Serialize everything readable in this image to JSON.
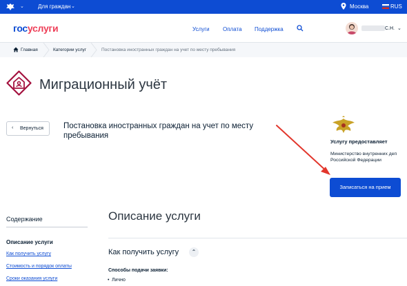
{
  "topbar": {
    "audience": "Для граждан",
    "city": "Москва",
    "language": "RUS"
  },
  "header": {
    "logo_part1": "гос",
    "logo_part2": "услуги",
    "nav": [
      "Услуги",
      "Оплата",
      "Поддержка"
    ],
    "user_initials": "С.Н."
  },
  "breadcrumb": {
    "items": [
      "Главная",
      "Категории услуг",
      "Постановка иностранных граждан на учет по месту пребывания"
    ]
  },
  "page": {
    "title": "Миграционный учёт",
    "back_label": "Вернуться",
    "service_name": "Постановка иностранных граждан на учет по месту пребывания"
  },
  "provider": {
    "label": "Услугу предоставляет",
    "name_line1": "Министерство внутренних деп",
    "name_line2": "Российской Федерации",
    "book_label": "Записаться на прием"
  },
  "toc": {
    "title": "Содержание",
    "active": "Описание услуги",
    "links": [
      "Как получить услугу",
      "Стоимость и порядок оплаты",
      "Сроки оказания услуги"
    ]
  },
  "description": {
    "title": "Описание услуги",
    "how_title": "Как получить услугу",
    "methods_label": "Способы подачи заявки:",
    "methods": [
      "Лично"
    ]
  },
  "colors": {
    "brand_blue": "#0d4cd3",
    "brand_red": "#ee3f58",
    "arrow_red": "#e2362c",
    "icon_maroon": "#a4123f"
  },
  "icons": [
    "emblem-icon",
    "chevron-down-icon",
    "location-pin-icon",
    "flag-icon",
    "search-icon",
    "home-icon",
    "service-house-icon",
    "mvd-emblem-icon",
    "back-arrow-icon",
    "chevron-up-icon"
  ]
}
